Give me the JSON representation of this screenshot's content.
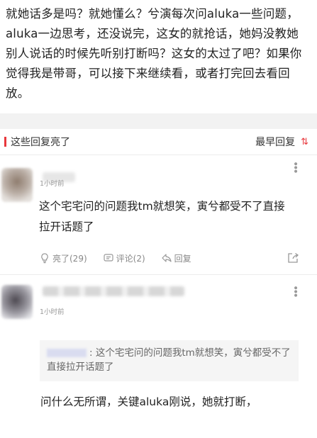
{
  "post": {
    "text": "就她话多是吗？就她懂么？兮演每次问aluka一些问题，aluka一边思考，还没说完，这女的就抢话，她妈没教她别人说话的时候先听别打断吗？这女的太过了吧？如果你觉得我是带哥，可以接下来继续看，或者打完回去看回放。"
  },
  "section": {
    "title": "这些回复亮了",
    "sort_label": "最早回复",
    "sort_icon": "⇅"
  },
  "comments": [
    {
      "time": "1小时前",
      "text": "这个宅宅问的问题我tm就想笑，寅兮都受不了直接拉开话题了",
      "likes_label": "亮了(29)",
      "comments_label": "评论(2)",
      "reply_label": "回复"
    },
    {
      "time": "1小时前",
      "quote_text": ": 这个宅宅问的问题我tm就想笑，寅兮都受不了直接拉开话题了",
      "text": "问什么无所谓，关键aluka刚说，她就打断，"
    }
  ],
  "icons": {
    "more": "more-icon",
    "like": "lightbulb-icon",
    "comment": "comment-icon",
    "reply": "reply-icon",
    "share": "share-icon"
  },
  "colors": {
    "accent": "#e8383d",
    "muted": "#999999"
  }
}
